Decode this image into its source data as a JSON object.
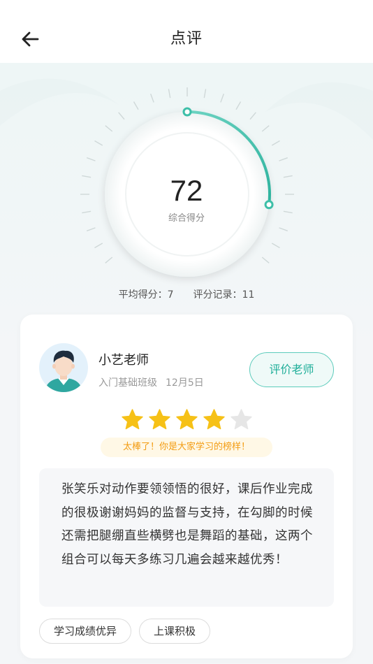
{
  "header": {
    "title": "点评",
    "back_icon": "arrow-left-icon"
  },
  "score": {
    "value": "72",
    "label": "综合得分",
    "progress_fraction": 0.27,
    "accent_color": "#3dbfa8"
  },
  "stats": {
    "average": "平均得分：7",
    "records": "评分记录：11"
  },
  "review": {
    "teacher_name": "小艺老师",
    "class_name": "入门基础班级",
    "date": "12月5日",
    "rate_button_label": "评价老师",
    "rating": 4,
    "rating_max": 5,
    "star_color": "#f6c117",
    "praise": "太棒了！你是大家学习的榜样！",
    "comment": "张笑乐对动作要领领悟的很好，课后作业完成的很极谢谢妈妈的监督与支持，在勾脚的时候还需把腿绷直些横劈也是舞蹈的基础，这两个组合可以每天多练习几遍会越来越优秀！",
    "tags": [
      "学习成绩优异",
      "上课积极"
    ]
  }
}
